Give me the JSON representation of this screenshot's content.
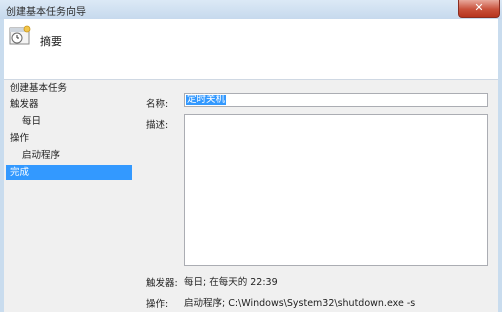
{
  "window": {
    "title": "创建基本任务向导",
    "close_label": "✕"
  },
  "header": {
    "icon": "clock-icon",
    "title": "摘要"
  },
  "nav": {
    "items": [
      {
        "label": "创建基本任务",
        "selected": false
      },
      {
        "label": "触发器",
        "selected": false
      },
      {
        "label": "每日",
        "selected": false
      },
      {
        "label": "操作",
        "selected": false
      },
      {
        "label": "启动程序",
        "selected": false
      },
      {
        "label": "完成",
        "selected": true
      }
    ]
  },
  "form": {
    "name_label": "名称:",
    "name_value": "定时关机",
    "description_label": "描述:",
    "description_value": ""
  },
  "summary": {
    "trigger_label": "触发器:",
    "trigger_value": "每日; 在每天的 22:39",
    "action_label": "操作:",
    "action_value": "启动程序; C:\\Windows\\System32\\shutdown.exe -s"
  },
  "colors": {
    "selection": "#3399ff",
    "titlebar": "#c6d9ed",
    "close": "#c8503a"
  }
}
